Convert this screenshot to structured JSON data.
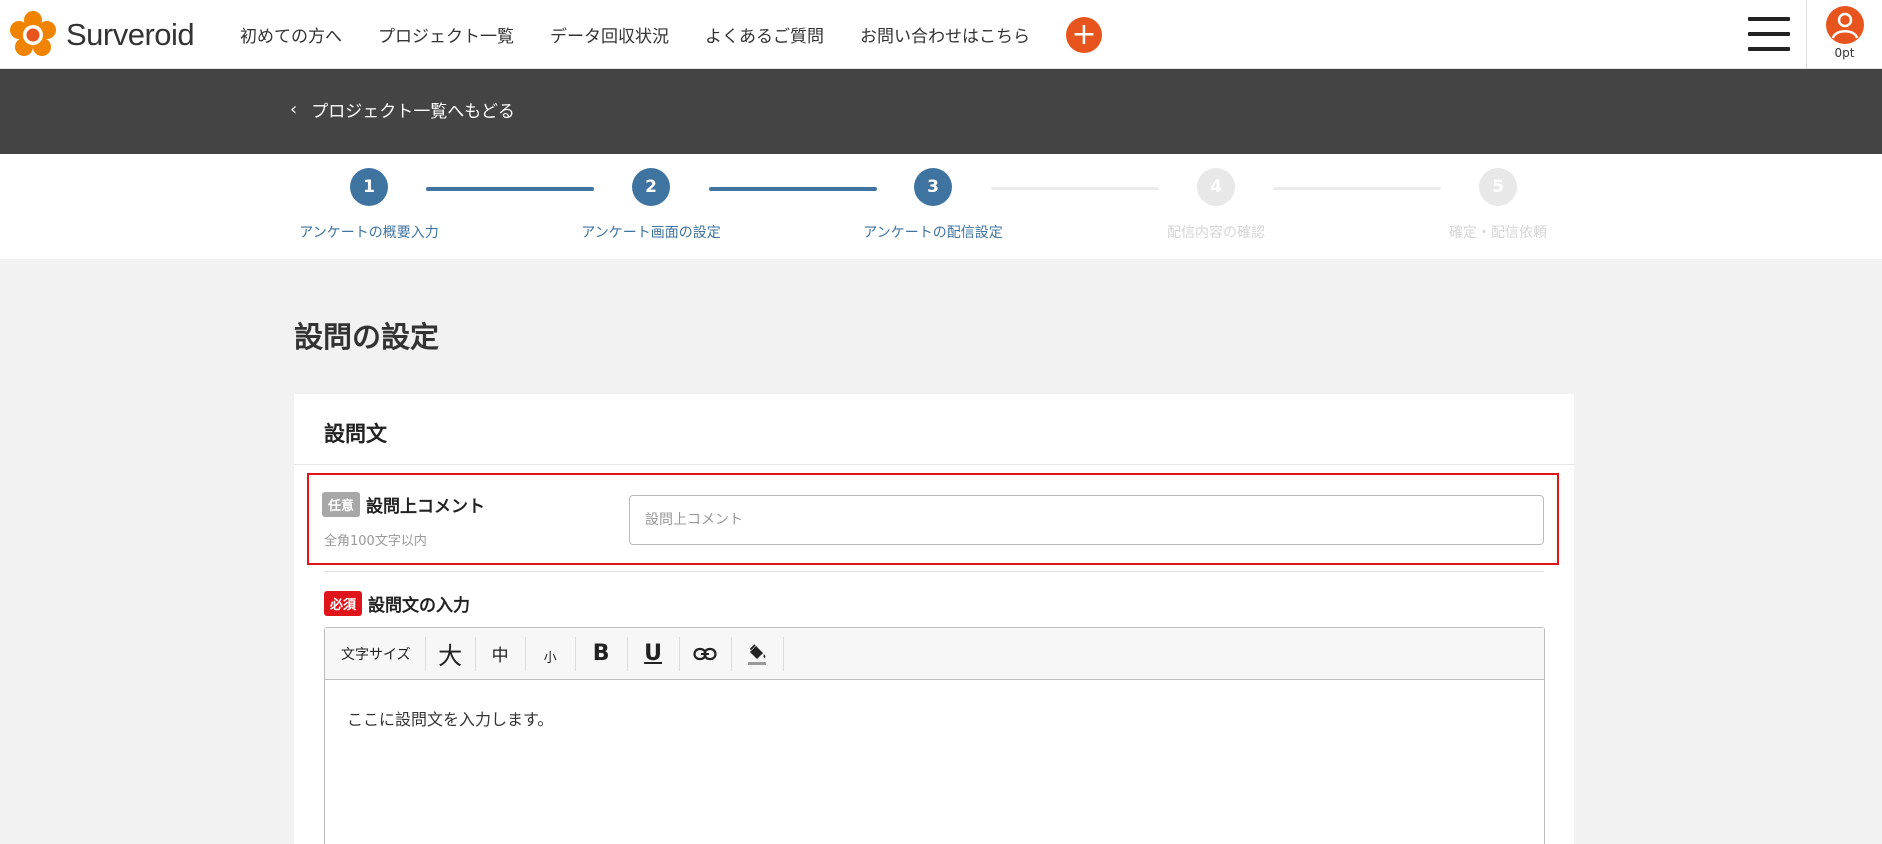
{
  "header": {
    "brand": "Surveroid",
    "nav": [
      "初めての方へ",
      "プロジェクト一覧",
      "データ回収状況",
      "よくあるご質問",
      "お問い合わせはこちら"
    ],
    "plus_icon": "+",
    "points": "0pt"
  },
  "backbar": {
    "back_label": "プロジェクト一覧へもどる",
    "chevron": "‹"
  },
  "steps": [
    {
      "number": "1",
      "label": "アンケートの概要入力",
      "state": "done"
    },
    {
      "number": "2",
      "label": "アンケート画面の設定",
      "state": "done"
    },
    {
      "number": "3",
      "label": "アンケートの配信設定",
      "state": "current"
    },
    {
      "number": "4",
      "label": "配信内容の確認",
      "state": "todo"
    },
    {
      "number": "5",
      "label": "確定・配信依頼",
      "state": "todo"
    }
  ],
  "page": {
    "title": "設問の設定"
  },
  "card": {
    "title": "設問文",
    "comment_field": {
      "badge": "任意",
      "label": "設問上コメント",
      "hint": "全角100文字以内",
      "placeholder": "設問上コメント"
    },
    "question_field": {
      "badge": "必須",
      "label": "設問文の入力"
    },
    "toolbar": {
      "size_label": "文字サイズ",
      "large": "大",
      "medium": "中",
      "small": "小",
      "bold": "B",
      "underline": "U"
    },
    "editor_text": "ここに設問文を入力します。"
  },
  "colors": {
    "accent": "#e8541d",
    "step_active": "#3f74a1",
    "required": "#e0141b",
    "highlight": "#e0141b"
  }
}
